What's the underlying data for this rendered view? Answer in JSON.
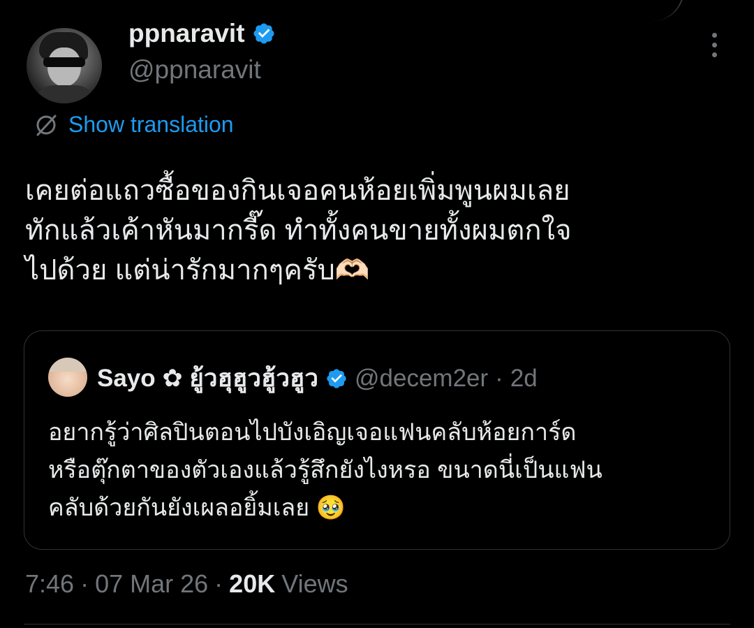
{
  "author": {
    "display_name": "ppnaravit",
    "handle": "@ppnaravit",
    "verified": true,
    "avatar_icon": "profile-photo"
  },
  "translate": {
    "label": "Show translation",
    "icon": "translate-globe-icon"
  },
  "tweet": {
    "text": "เคยต่อแถวซื้อของกินเจอคนห้อยเพิ่มพูนผมเลย\nทักแล้วเค้าหันมากรี๊ด ทำทั้งคนขายทั้งผมตกใจ\nไปด้วย แต่น่ารักมากๆครับ🫶🏻"
  },
  "quote": {
    "display_name": "Sayo ✿ ยู้วฮุฮูวฮู้วฮูว",
    "handle": "@decem2er",
    "separator": "·",
    "time": "2d",
    "verified": true,
    "text": "อยากรู้ว่าศิลปินตอนไปบังเอิญเจอแฟนคลับห้อยการ์ด\nหรือตุ๊กตาของตัวเองแล้วรู้สึกยังไงหรอ ขนาดนี่เป็นแฟน\nคลับด้วยกันยังเผลอยิ้มเลย 🥹"
  },
  "meta": {
    "time": "7:46",
    "sep1": "·",
    "date": "07 Mar 26",
    "sep2": "·",
    "views_count": "20K",
    "views_label": "Views"
  },
  "colors": {
    "background": "#000000",
    "text": "#e7e9ea",
    "muted": "#71767b",
    "accent": "#1d9bf0",
    "border": "#2f3336"
  }
}
